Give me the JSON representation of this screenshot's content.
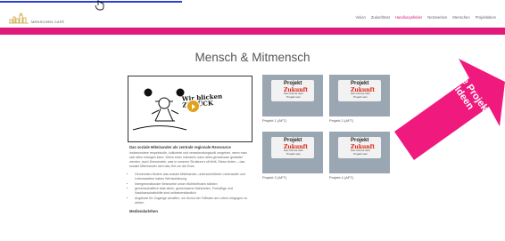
{
  "progress": {
    "fraction": 0.36
  },
  "header": {
    "logo_text": "MENSCHEN CAFÉ",
    "logo_sub": "",
    "nav": [
      "Vision",
      "Zukunftsrat",
      "Handlungsfelder",
      "Netzwerken",
      "Menschen",
      "Projektideen"
    ],
    "active_nav": "Handlungsfelder"
  },
  "page": {
    "title": "Mensch & Mitmensch"
  },
  "video": {
    "overlay_text": "Wir blicken\nZURÜCK"
  },
  "content": {
    "subhead": "Das soziale Miteinander als zentrale regionale Ressource",
    "paragraph": "Insbesondere respektvolle, kultivierte und verantwortungsvoll umgehen, wenn man sich alles erlangen kann. Wenn einer mitmacht, kann alles gemeinsam gestaltet werden, auch Demokratie, was in unseren Strukturen oft fehlt. Diese fehlen – das soziale Miteinander wird das Ziel um die Ecke.",
    "bullets": [
      "Gemeinden fördern das soziale Miteinander, unterschiedliche Lebensstile und Lebenswelten haben Wertschätzung",
      "Intergenerationale Netzwerke unser Wohlbefinden stärken",
      "gemeinschaftlich statt allein, gemeinsame Mahlzeiten, Freiwillige und Nachbarschaftshilfe sind selbstverständlich",
      "Angebote für Zugänge schaffen, um Armut der Teilhabe am Leben entgegen zu wirken"
    ],
    "subhead2": "Mediendarlehen"
  },
  "projects": [
    {
      "title": "Projekt",
      "word": "Zukunft",
      "line": "Hier könnte dein Projekt sein",
      "caption": "Projekt 1 (AFT)"
    },
    {
      "title": "Projekt",
      "word": "Zukunft",
      "line": "Hier könnte dein Projekt sein",
      "caption": "Projekt 2 (AFT)"
    },
    {
      "title": "Projekt",
      "word": "Zukunft",
      "line": "Hier könnte dein Projekt sein",
      "caption": "Projekt 3 (AFT)"
    },
    {
      "title": "Projekt",
      "word": "Zukunft",
      "line": "Hier könnte dein Projekt sein",
      "caption": "Projekt 4 (AFT)"
    }
  ],
  "arrow": {
    "text": "Alle Projekt-Ideen",
    "color": "#f0197d"
  },
  "colors": {
    "accent": "#e0197d",
    "progress": "#2c3fd0"
  }
}
